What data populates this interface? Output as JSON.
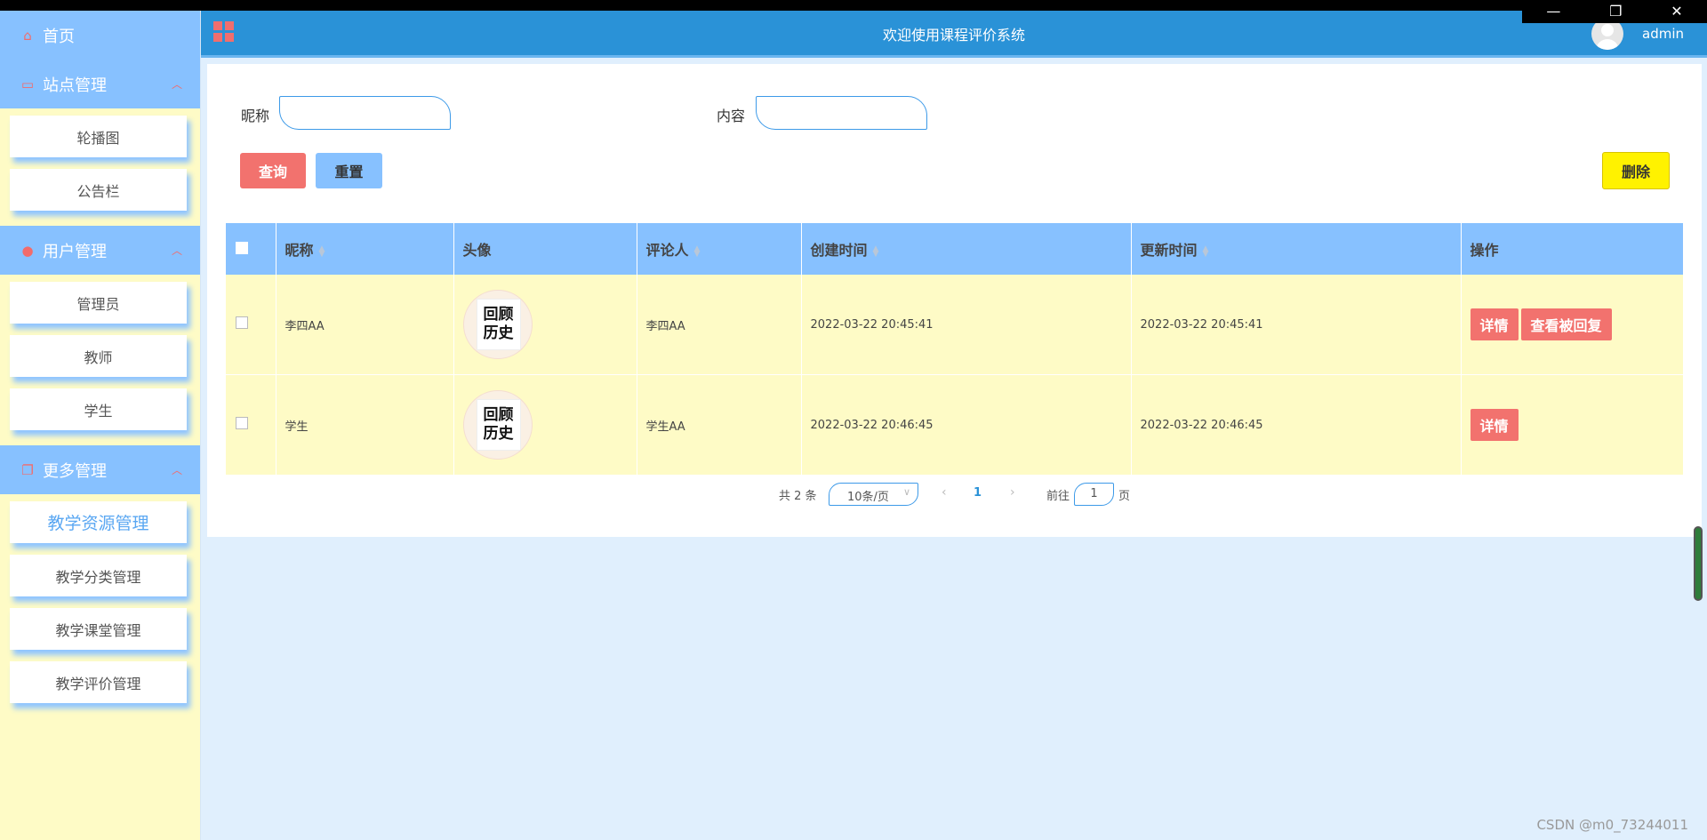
{
  "window": {
    "minimize": "—",
    "restore": "❐",
    "close": "✕"
  },
  "sidebar": {
    "home": {
      "icon": "home-icon",
      "label": "首页"
    },
    "groups": [
      {
        "icon": "monitor-icon",
        "label": "站点管理",
        "arrow": "︿",
        "items": [
          "轮播图",
          "公告栏"
        ]
      },
      {
        "icon": "user-icon",
        "label": "用户管理",
        "arrow": "︿",
        "items": [
          "管理员",
          "教师",
          "学生"
        ]
      },
      {
        "icon": "copy-icon",
        "label": "更多管理",
        "arrow": "︿",
        "items": [
          "教学资源管理",
          "教学分类管理",
          "教学课堂管理",
          "教学评价管理"
        ],
        "active_index": 0
      }
    ]
  },
  "header": {
    "title": "欢迎使用课程评价系统",
    "user": "admin"
  },
  "search": {
    "nickname_label": "昵称",
    "nickname_value": "",
    "content_label": "内容",
    "content_value": "",
    "query_button": "查询",
    "reset_button": "重置",
    "delete_button": "删除"
  },
  "table": {
    "columns": [
      "昵称",
      "头像",
      "评论人",
      "创建时间",
      "更新时间",
      "操作"
    ],
    "sort_icon": "sort-icon",
    "rows": [
      {
        "nickname": "李四AA",
        "avatar_text": [
          "回顾",
          "历史"
        ],
        "commenter": "李四AA",
        "created": "2022-03-22 20:45:41",
        "updated": "2022-03-22 20:45:41",
        "actions": [
          "详情",
          "查看被回复"
        ]
      },
      {
        "nickname": "学生",
        "avatar_text": [
          "回顾",
          "历史"
        ],
        "commenter": "学生AA",
        "created": "2022-03-22 20:46:45",
        "updated": "2022-03-22 20:46:45",
        "actions": [
          "详情"
        ]
      }
    ]
  },
  "pagination": {
    "total": "共 2 条",
    "page_size": "10条/页",
    "current_page": "1",
    "goto_label": "前往",
    "goto_value": "1",
    "page_suffix": "页"
  },
  "watermark": "CSDN @m0_73244011",
  "colors": {
    "header": "#2a92d7",
    "sidebar_head": "#87c1ff",
    "sidebar_bg": "#fefbc6",
    "danger": "#f2726e",
    "warn": "#fff200"
  }
}
